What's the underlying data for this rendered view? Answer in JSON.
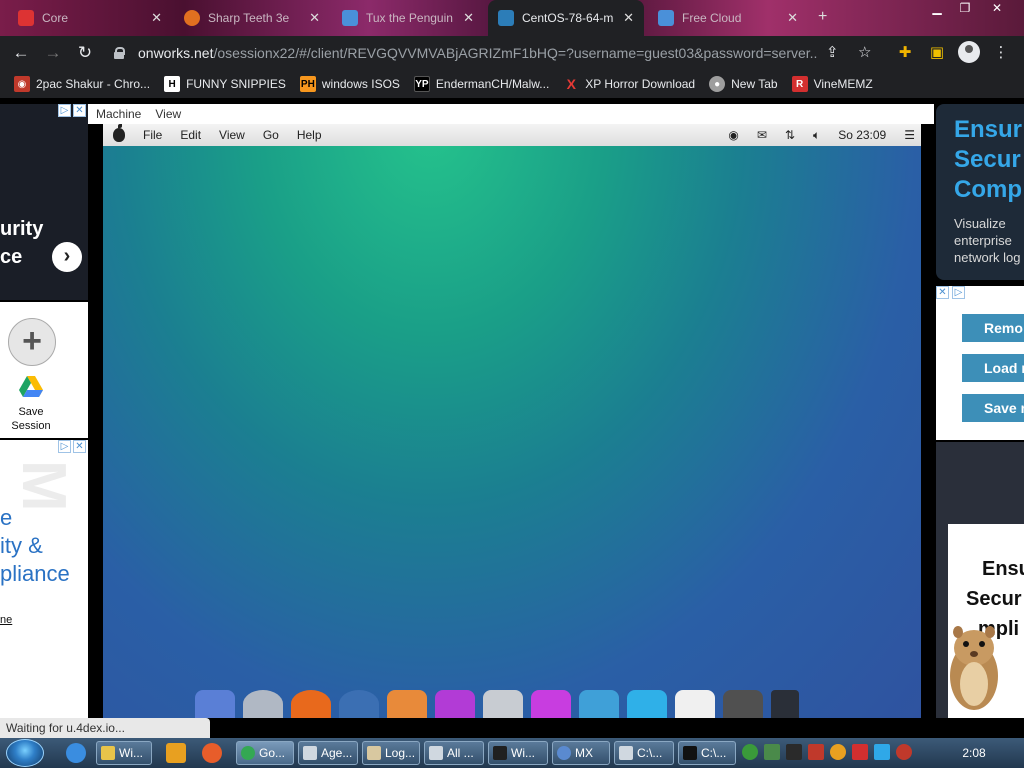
{
  "browser": {
    "tabs": [
      {
        "label": "Core",
        "active": false
      },
      {
        "label": "Sharp Teeth 3e",
        "active": false
      },
      {
        "label": "Tux the Penguin",
        "active": false
      },
      {
        "label": "CentOS-78-64-m",
        "active": true
      },
      {
        "label": "Free Cloud",
        "active": false
      }
    ],
    "url_host": "onworks.net",
    "url_path": "/osessionx22/#/client/REVGQVVMVABjAGRIZmF1bHQ=?username=guest03&password=server...",
    "bookmarks": [
      {
        "label": "2pac Shakur - Chro...",
        "icon": "tupac-icon",
        "color": "#c0392b"
      },
      {
        "label": "FUNNY SNIPPIES",
        "icon": "H",
        "color": "#ffffff"
      },
      {
        "label": "windows ISOS",
        "icon": "PH",
        "color": "#f7971e"
      },
      {
        "label": "EndermanCH/Malw...",
        "icon": "YP",
        "color": "#000000"
      },
      {
        "label": "XP Horror Download",
        "icon": "X",
        "color": "#e53935"
      },
      {
        "label": "New Tab",
        "icon": "globe-icon",
        "color": "#9e9e9e"
      },
      {
        "label": "VineMEMZ",
        "icon": "R",
        "color": "#d32f2f"
      }
    ],
    "status_text": "Waiting for u.4dex.io..."
  },
  "session_panel": {
    "save_label_line1": "Save",
    "save_label_line2": "Session"
  },
  "left_ad": {
    "line1": "urity",
    "line2": "ce",
    "lower_lines": [
      "e",
      "ity &",
      "pliance"
    ],
    "lower_small": "ne"
  },
  "vm": {
    "menubar": [
      "Machine",
      "View"
    ],
    "mac_menu": [
      "File",
      "Edit",
      "View",
      "Go",
      "Help"
    ],
    "clock": "So 23:09"
  },
  "right_ad": {
    "heading": [
      "Ensur",
      "Secur",
      "Comp"
    ],
    "sub": [
      "Visualize",
      "enterprise",
      "network log"
    ],
    "buttons": [
      "Remo",
      "Load r",
      "Save r"
    ],
    "card_lines": [
      "Ensu",
      "Secur",
      "mpli"
    ]
  },
  "taskbar": {
    "tasks": [
      "Wi...",
      "Go...",
      "Age...",
      "Log...",
      "All ...",
      "Wi...",
      "MX",
      "C:\\...",
      "C:\\..."
    ],
    "time": "2:08 PM"
  }
}
